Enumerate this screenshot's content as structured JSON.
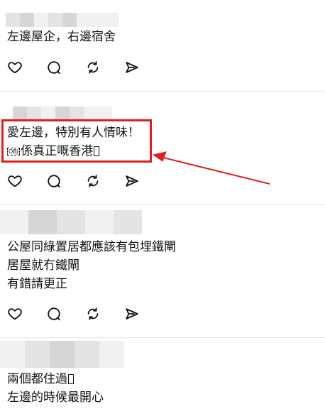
{
  "posts": [
    {
      "lines": [
        "左邊屋企，右邊宿舍"
      ],
      "actions": [
        "like",
        "reply",
        "repost",
        "share"
      ]
    },
    {
      "lines": [
        "愛左邊，特別有人情味！",
        "係真正嘅香港"
      ],
      "first_prefix_glyph": "OBJ",
      "actions": [
        "like",
        "reply",
        "repost",
        "share"
      ]
    },
    {
      "lines": [
        "公屋同綠置居都應該有包埋鐵閘",
        "居屋就冇鐵閘",
        "有錯請更正"
      ],
      "actions": [
        "like",
        "reply",
        "repost",
        "share"
      ]
    },
    {
      "lines": [
        "兩個都住過",
        "左邊的時候最開心"
      ]
    }
  ],
  "icons": {
    "like": "heart-icon",
    "reply": "speech-bubble-icon",
    "repost": "repost-arrows-icon",
    "share": "send-icon"
  },
  "annotation_color": "#e02020"
}
